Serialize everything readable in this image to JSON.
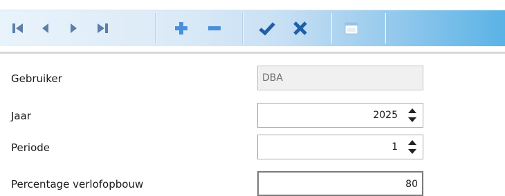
{
  "toolbar": {
    "buttons": [
      {
        "name": "first-record-button",
        "icon": "first-record-icon"
      },
      {
        "name": "prior-record-button",
        "icon": "prior-record-icon"
      },
      {
        "name": "next-record-button",
        "icon": "next-record-icon"
      },
      {
        "name": "last-record-button",
        "icon": "last-record-icon"
      },
      {
        "name": "insert-record-button",
        "icon": "plus-icon"
      },
      {
        "name": "delete-record-button",
        "icon": "minus-icon"
      },
      {
        "name": "post-button",
        "icon": "checkmark-icon"
      },
      {
        "name": "cancel-button",
        "icon": "cross-icon"
      },
      {
        "name": "calendar-button",
        "icon": "calendar-icon"
      }
    ],
    "colors": {
      "nav": "#5b7fa8",
      "plus_minus": "#4a90d9",
      "check_cross": "#1f5fa6"
    }
  },
  "form": {
    "fields": [
      {
        "label": "Gebruiker",
        "value": "DBA"
      },
      {
        "label": "Jaar",
        "value": "2025"
      },
      {
        "label": "Periode",
        "value": "1"
      },
      {
        "label": "Percentage verlofopbouw",
        "value": "80"
      }
    ]
  }
}
